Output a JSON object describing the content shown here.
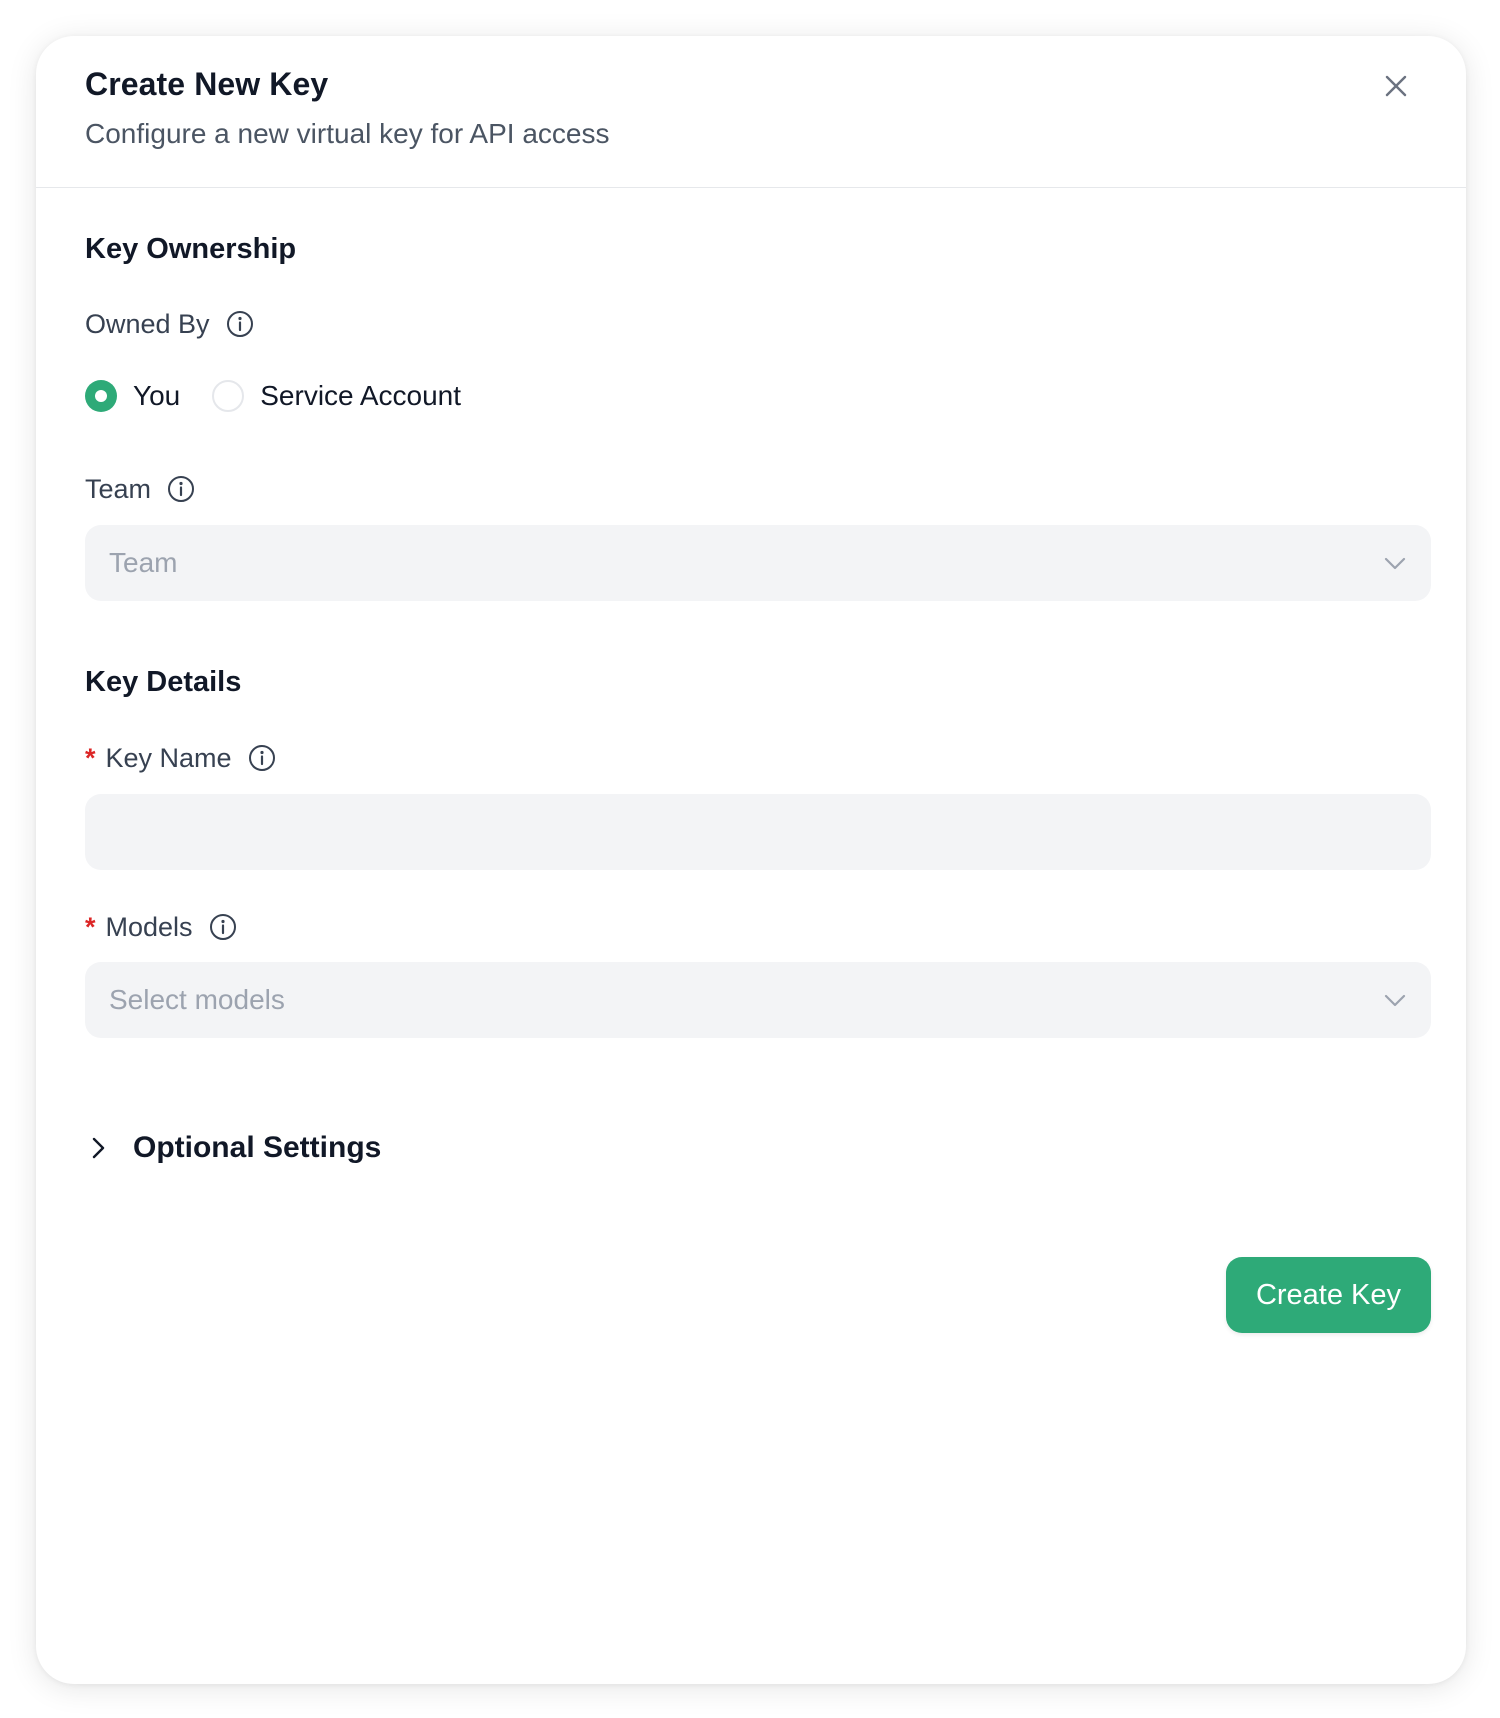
{
  "dialog": {
    "title": "Create New Key",
    "subtitle": "Configure a new virtual key for API access"
  },
  "ownership": {
    "heading": "Key Ownership",
    "owned_by_label": "Owned By",
    "options": [
      {
        "label": "You",
        "selected": true
      },
      {
        "label": "Service Account",
        "selected": false
      }
    ],
    "team_label": "Team",
    "team_placeholder": "Team"
  },
  "details": {
    "heading": "Key Details",
    "key_name_label": "Key Name",
    "key_name_value": "",
    "required_marker": "*",
    "models_label": "Models",
    "models_placeholder": "Select models"
  },
  "optional_settings": {
    "label": "Optional Settings",
    "expanded": false
  },
  "actions": {
    "create_label": "Create Key"
  },
  "colors": {
    "accent": "#2eaa78",
    "required": "#dc2626",
    "input_bg": "#f3f4f6"
  },
  "icons": {
    "close": "close-icon",
    "info": "info-icon",
    "chevron_down": "chevron-down-icon",
    "chevron_right": "chevron-right-icon"
  }
}
